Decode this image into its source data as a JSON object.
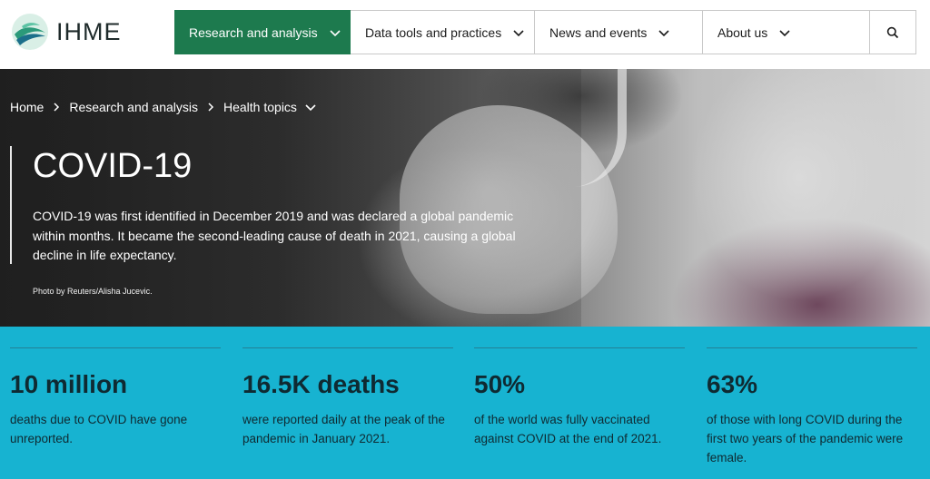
{
  "brand": {
    "name": "IHME",
    "colors": {
      "nav_active": "#1d7a4e",
      "stats_bg": "#17b3d1"
    }
  },
  "nav": {
    "items": [
      {
        "label": "Research and analysis",
        "icon": "chevron-down-icon",
        "active": true
      },
      {
        "label": "Data tools and practices",
        "icon": "chevron-down-icon",
        "active": false
      },
      {
        "label": "News and events",
        "icon": "chevron-down-icon",
        "active": false
      },
      {
        "label": "About us",
        "icon": "chevron-down-icon",
        "active": false
      }
    ],
    "search_icon": "search-icon"
  },
  "breadcrumb": {
    "items": [
      "Home",
      "Research and analysis",
      "Health topics"
    ],
    "separator_icon": "chevron-right-icon",
    "dropdown_icon": "chevron-down-icon"
  },
  "hero": {
    "title": "COVID-19",
    "description": "COVID-19 was first identified in December 2019 and was declared a global pandemic within months. It became the second-leading cause of death in 2021, causing a global decline in life expectancy.",
    "credit": "Photo by Reuters/Alisha Jucevic."
  },
  "stats": [
    {
      "value": "10 million",
      "text": "deaths due to COVID have gone unreported."
    },
    {
      "value": "16.5K deaths",
      "text": "were reported daily at the peak of the pandemic in January 2021."
    },
    {
      "value": "50%",
      "text": "of the world was fully vaccinated against COVID at the end of 2021."
    },
    {
      "value": "63%",
      "text": "of those with long COVID during the first two years of the pandemic were female."
    }
  ]
}
